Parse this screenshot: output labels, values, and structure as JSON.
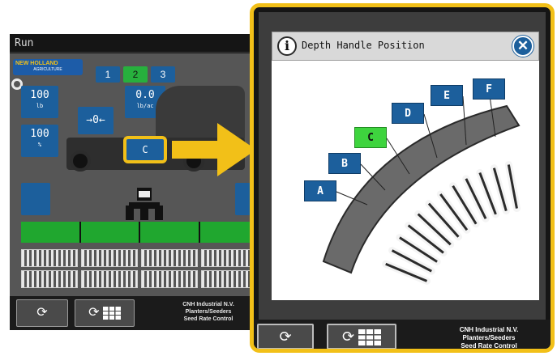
{
  "run_screen": {
    "title": "Run",
    "logo": {
      "brand": "NEW HOLLAND",
      "sub": "AGRICULTURE"
    },
    "section_buttons": [
      "1",
      "2",
      "3"
    ],
    "active_section": "2",
    "values": [
      {
        "value": "100",
        "unit": "lb"
      },
      {
        "value": "0.0",
        "unit": "lb/ac"
      },
      {
        "value": "100",
        "unit": "%"
      }
    ],
    "offset_label": "→0←",
    "depth_position_label": "C",
    "company_lines": [
      "CNH Industrial N.V.",
      "Planters/Seeders",
      "Seed Rate Control"
    ]
  },
  "dialog": {
    "title": "Depth Handle Position",
    "info_icon": "i",
    "close_icon": "✕",
    "positions": [
      "A",
      "B",
      "C",
      "D",
      "E",
      "F"
    ],
    "selected_position": "C"
  },
  "bottom_bar": {
    "refresh_icon": "⟳",
    "grid_icon": "grid"
  },
  "colors": {
    "accent_blue": "#1c5f9c",
    "selected_green": "#3ed43e",
    "highlight_yellow": "#f2c018"
  }
}
